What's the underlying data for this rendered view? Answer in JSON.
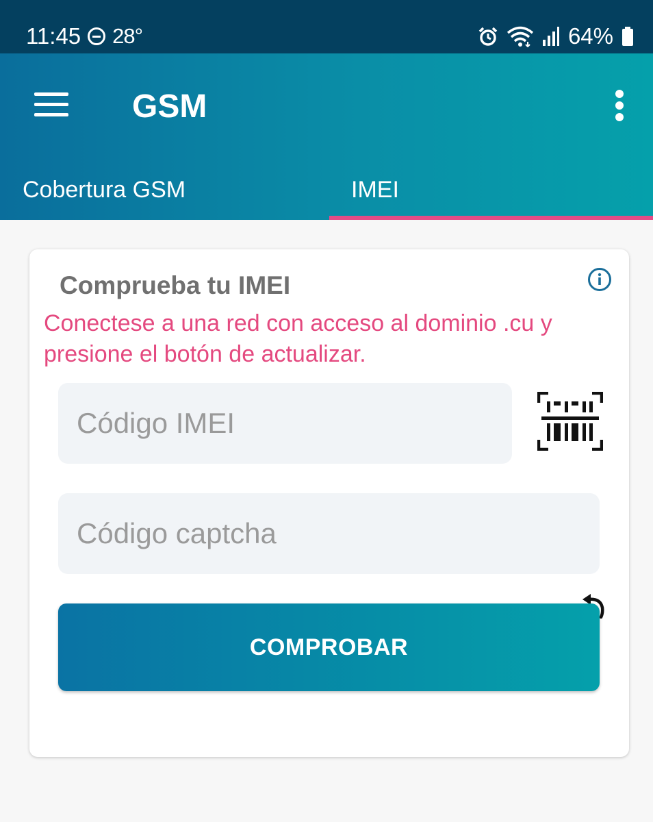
{
  "status_bar": {
    "time": "11:45",
    "temperature": "28°",
    "battery": "64%"
  },
  "app_bar": {
    "title": "GSM"
  },
  "tabs": [
    {
      "label": "Cobertura GSM",
      "selected": false
    },
    {
      "label": "IMEI",
      "selected": true
    }
  ],
  "card": {
    "title": "Comprueba tu IMEI",
    "warning": "Conectese a una red con acceso al dominio .cu y presione el botón de actualizar.",
    "imei_placeholder": "Código IMEI",
    "captcha_placeholder": "Código captcha",
    "submit_label": "COMPROBAR"
  },
  "colors": {
    "status_bar": "#04405f",
    "accent": "#e44b86",
    "primary": "#0a8ea7",
    "info_icon": "#1a6e9a"
  }
}
